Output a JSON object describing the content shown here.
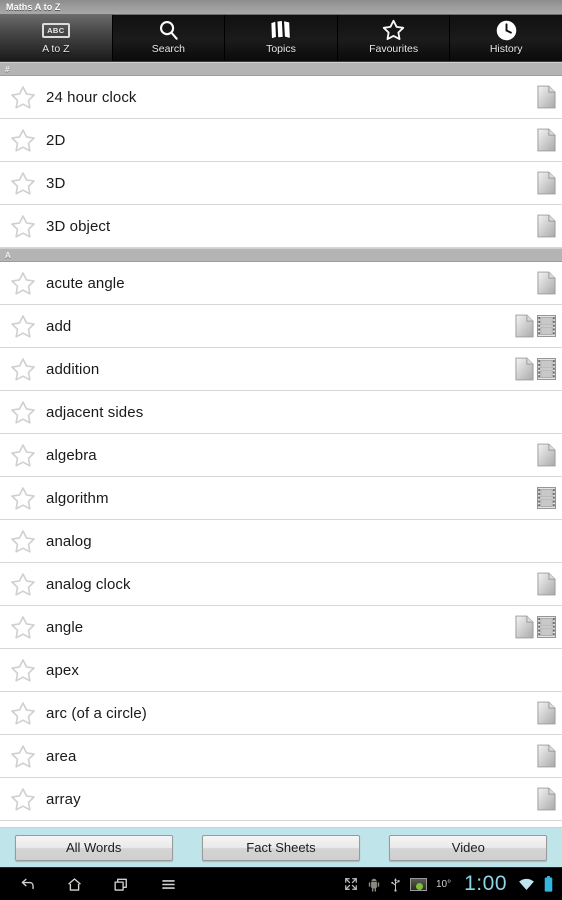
{
  "window": {
    "title": "Maths A to Z"
  },
  "tabs": [
    {
      "label": "A to Z",
      "icon": "abc-icon",
      "selected": true
    },
    {
      "label": "Search",
      "icon": "search-icon",
      "selected": false
    },
    {
      "label": "Topics",
      "icon": "cards-icon",
      "selected": false
    },
    {
      "label": "Favourites",
      "icon": "star-icon",
      "selected": false
    },
    {
      "label": "History",
      "icon": "clock-icon",
      "selected": false
    }
  ],
  "list": {
    "sections": [
      {
        "header": "#",
        "items": [
          {
            "label": "24 hour clock",
            "favourite": false,
            "icons": [
              "document-icon"
            ]
          },
          {
            "label": "2D",
            "favourite": false,
            "icons": [
              "document-icon"
            ]
          },
          {
            "label": "3D",
            "favourite": false,
            "icons": [
              "document-icon"
            ]
          },
          {
            "label": "3D object",
            "favourite": false,
            "icons": [
              "document-icon"
            ]
          }
        ]
      },
      {
        "header": "A",
        "items": [
          {
            "label": "acute angle",
            "favourite": false,
            "icons": [
              "document-icon"
            ]
          },
          {
            "label": "add",
            "favourite": false,
            "icons": [
              "document-icon",
              "film-icon"
            ]
          },
          {
            "label": "addition",
            "favourite": false,
            "icons": [
              "document-icon",
              "film-icon"
            ]
          },
          {
            "label": "adjacent sides",
            "favourite": false,
            "icons": []
          },
          {
            "label": "algebra",
            "favourite": false,
            "icons": [
              "document-icon"
            ]
          },
          {
            "label": "algorithm",
            "favourite": false,
            "icons": [
              "film-icon"
            ]
          },
          {
            "label": "analog",
            "favourite": false,
            "icons": []
          },
          {
            "label": "analog clock",
            "favourite": false,
            "icons": [
              "document-icon"
            ]
          },
          {
            "label": "angle",
            "favourite": false,
            "icons": [
              "document-icon",
              "film-icon"
            ]
          },
          {
            "label": "apex",
            "favourite": false,
            "icons": []
          },
          {
            "label": "arc (of a circle)",
            "favourite": false,
            "icons": [
              "document-icon"
            ]
          },
          {
            "label": "area",
            "favourite": false,
            "icons": [
              "document-icon"
            ]
          },
          {
            "label": "array",
            "favourite": false,
            "icons": [
              "document-icon"
            ]
          }
        ]
      }
    ]
  },
  "filter_bar": {
    "buttons": [
      {
        "label": "All Words"
      },
      {
        "label": "Fact Sheets"
      },
      {
        "label": "Video"
      }
    ]
  },
  "navbar": {
    "left_icons": [
      "back-icon",
      "home-icon",
      "recents-icon",
      "menu-icon"
    ],
    "status_icons": [
      "fullscreen-icon",
      "android-debug-icon",
      "usb-icon",
      "app-thumbnail-icon"
    ],
    "temperature": "10°",
    "clock": "1:00",
    "right_icons": [
      "wifi-icon",
      "battery-icon"
    ]
  },
  "colors": {
    "titlebar": "#9b9b9b",
    "tabbar": "#101010",
    "section_header": "#b4b4b4",
    "filter_bar": "#bfe4e9",
    "clock_text": "#8fd3e8",
    "battery": "#34b6e0"
  }
}
